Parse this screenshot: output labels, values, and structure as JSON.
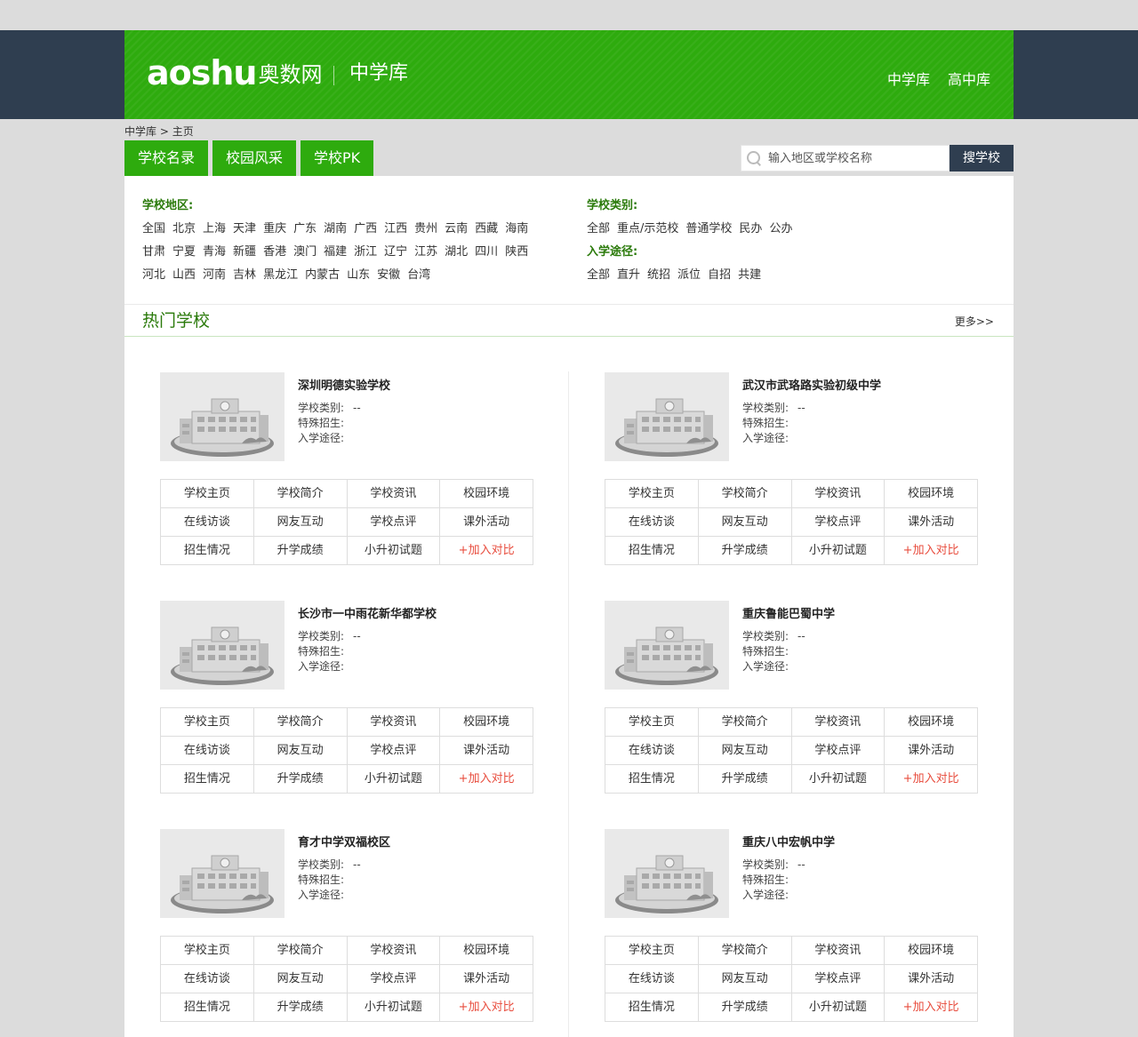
{
  "header": {
    "logo_mark": "aoshu",
    "logo_cn": "奥数网",
    "logo_sub": "中学库",
    "nav": [
      "中学库",
      "高中库"
    ]
  },
  "breadcrumb": {
    "root": "中学库",
    "sep": ">",
    "current": "主页"
  },
  "tabs": [
    "学校名录",
    "校园风采",
    "学校PK"
  ],
  "search": {
    "placeholder": "输入地区或学校名称",
    "button": "搜学校"
  },
  "filters": {
    "region_title": "学校地区:",
    "region_rows": [
      [
        "全国",
        "北京",
        "上海",
        "天津",
        "重庆",
        "广东",
        "湖南",
        "广西",
        "江西",
        "贵州",
        "云南",
        "西藏",
        "海南"
      ],
      [
        "甘肃",
        "宁夏",
        "青海",
        "新疆",
        "香港",
        "澳门",
        "福建",
        "浙江",
        "辽宁",
        "江苏",
        "湖北",
        "四川",
        "陕西"
      ],
      [
        "河北",
        "山西",
        "河南",
        "吉林",
        "黑龙江",
        "内蒙古",
        "山东",
        "安徽",
        "台湾"
      ]
    ],
    "type_title": "学校类别:",
    "type_items": [
      "全部",
      "重点/示范校",
      "普通学校",
      "民办",
      "公办"
    ],
    "admission_title": "入学途径:",
    "admission_items": [
      "全部",
      "直升",
      "统招",
      "派位",
      "自招",
      "共建"
    ]
  },
  "hot": {
    "title": "热门学校",
    "more": "更多>>"
  },
  "meta_labels": {
    "type": "学校类别:",
    "special": "特殊招生:",
    "path": "入学途径:"
  },
  "links": [
    "学校主页",
    "学校简介",
    "学校资讯",
    "校园环境",
    "在线访谈",
    "网友互动",
    "学校点评",
    "课外活动",
    "招生情况",
    "升学成绩",
    "小升初试题",
    "+加入对比"
  ],
  "schools": [
    {
      "name": "深圳明德实验学校",
      "type": "--"
    },
    {
      "name": "武汉市武珞路实验初级中学",
      "type": "--"
    },
    {
      "name": "长沙市一中雨花新华都学校",
      "type": "--"
    },
    {
      "name": "重庆鲁能巴蜀中学",
      "type": "--"
    },
    {
      "name": "育才中学双福校区",
      "type": "--"
    },
    {
      "name": "重庆八中宏帆中学",
      "type": "--"
    }
  ],
  "colors": {
    "brand_green": "#2eab0e",
    "dark_navy": "#2f3e50",
    "compare_red": "#e84c3d"
  }
}
